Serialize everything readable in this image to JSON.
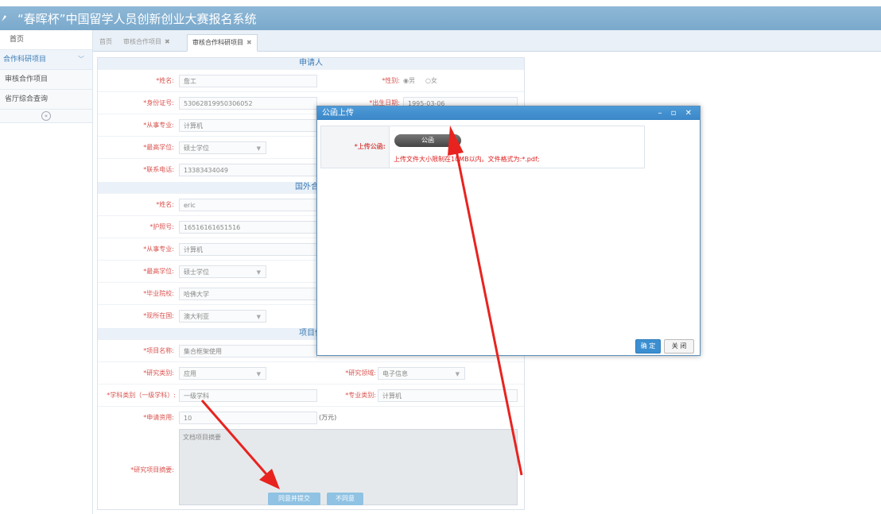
{
  "app_title": "“春晖杯”中国留学人员创新创业大赛报名系统",
  "sidebar": {
    "home": "首页",
    "group": "合作科研项目",
    "items": [
      "审核合作项目",
      "省厅综合查询"
    ]
  },
  "tabs": [
    {
      "label": "首页"
    },
    {
      "label": "审核合作项目",
      "close": "✖"
    },
    {
      "label": "审核合作科研项目",
      "close": "✖"
    }
  ],
  "form": {
    "sections": {
      "applicant": "申请人",
      "foreign": "国外合作",
      "project": "项目信"
    },
    "applicant": {
      "name_label": "*姓名:",
      "name": "詹工",
      "gender_label": "*性别:",
      "gender_male": "男",
      "gender_female": "女",
      "id_label": "*身份证号:",
      "id": "53062819950306052",
      "birth_label": "*出生日期:",
      "birth": "1995-03-06",
      "major_label": "*从事专业:",
      "major": "计算机",
      "degree_label": "*最高学位:",
      "degree": "硕士学位",
      "phone_label": "*联系电话:",
      "phone": "13383434049"
    },
    "foreign": {
      "name_label": "*姓名:",
      "name": "eric",
      "passport_label": "*护照号:",
      "passport": "16516161651516",
      "major_label": "*从事专业:",
      "major": "计算机",
      "degree_label": "*最高学位:",
      "degree": "硕士学位",
      "school_label": "*毕业院校:",
      "school": "哈佛大学",
      "country_label": "*现所在国:",
      "country": "澳大利亚"
    },
    "project": {
      "name_label": "*项目名称:",
      "name": "集合框架使用",
      "type_label": "*研究类别:",
      "type": "应用",
      "field_label": "*研究领域:",
      "field": "电子信息",
      "subject_label": "*学科类别（一级学科）:",
      "subject": "一级学科",
      "prof_label": "*专业类别:",
      "prof": "计算机",
      "fund_label": "*申请资用:",
      "fund": "10",
      "fund_unit": "(万元)",
      "summary_label": "*研究项目摘要:",
      "summary": "文档项目摘要"
    },
    "buttons": {
      "approve": "同意并提交",
      "reject": "不同意"
    }
  },
  "modal": {
    "title": "公函上传",
    "controls": "– ▫ ✕",
    "upload_label": "*上传公函:",
    "upload_button": "公函",
    "hint": "上传文件大小限制在10MB以内。文件格式为:*.pdf;",
    "ok": "确 定",
    "close": "关 闭"
  },
  "colors": {
    "titlebar": "#7aa9cc",
    "modal_header": "#3a86c7",
    "arrow": "#e8231f",
    "required": "#d9534f"
  }
}
